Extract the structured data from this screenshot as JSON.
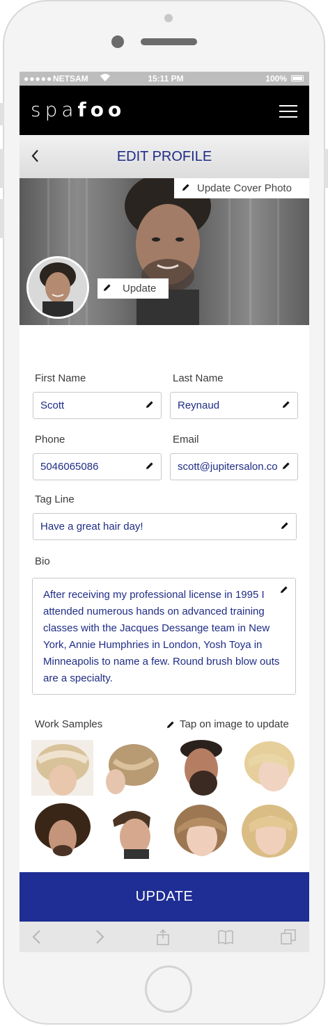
{
  "device": {
    "carrier": "NETSAM",
    "signal": "●●●●●",
    "time": "15:11 PM",
    "battery": "100%"
  },
  "app": {
    "logo_light": "spa",
    "logo_bold": "foo"
  },
  "header": {
    "title": "EDIT PROFILE"
  },
  "cover": {
    "update_cover_label": "Update Cover Photo",
    "update_avatar_label": "Update"
  },
  "form": {
    "first_name": {
      "label": "First Name",
      "value": "Scott"
    },
    "last_name": {
      "label": "Last Name",
      "value": "Reynaud"
    },
    "phone": {
      "label": "Phone",
      "value": "5046065086"
    },
    "email": {
      "label": "Email",
      "value": "scott@jupitersalon.com"
    },
    "tag_line": {
      "label": "Tag Line",
      "value": "Have a great hair day!"
    },
    "bio": {
      "label": "Bio",
      "value": "After receiving my professional license in 1995 I attended numerous hands on advanced training classes with the Jacques Dessange  team in New York, Annie Humphries in London, Yosh Toya in Minneapolis to name a few. Round brush blow outs are a specialty."
    }
  },
  "work_samples": {
    "label": "Work Samples",
    "hint": "Tap on image to update",
    "images": [
      "braided-updo-headband",
      "blonde-twisted-updo",
      "bearded-man-profile",
      "blonde-pixie-bob",
      "curly-haired-man",
      "man-pompadour-fade",
      "brown-bob-woman",
      "blonde-layered-fringe"
    ]
  },
  "actions": {
    "update_label": "UPDATE"
  },
  "colors": {
    "brand_blue": "#1f2e94",
    "text_blue": "#1f2c86",
    "navbar": "#000000"
  }
}
